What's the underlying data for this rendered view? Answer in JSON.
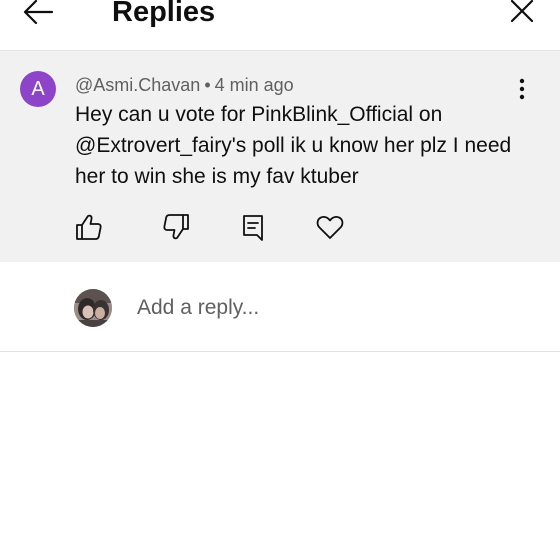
{
  "header": {
    "title": "Replies",
    "back_icon": "arrow-left-icon",
    "close_icon": "close-icon"
  },
  "comment": {
    "avatar_letter": "A",
    "avatar_color": "#8e44c9",
    "author": "@Asmi.Chavan",
    "separator": "•",
    "time": "4 min ago",
    "text": "Hey can u vote for PinkBlink_Official on @Extrovert_fairy's poll ik u know her plz I need her to win she is my fav ktuber",
    "more_icon": "more-vertical-icon",
    "actions": [
      "thumbs-up-icon",
      "thumbs-down-icon",
      "reply-icon",
      "heart-icon"
    ]
  },
  "reply": {
    "placeholder": "Add a reply..."
  },
  "colors": {
    "card_background": "#f1f1f1",
    "meta_text": "#606060",
    "primary_text": "#0f0f0f"
  }
}
